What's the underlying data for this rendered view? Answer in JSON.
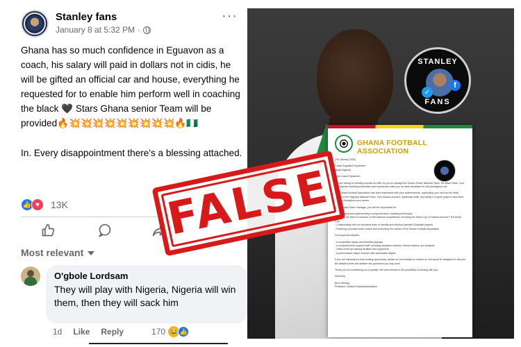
{
  "post": {
    "page_name": "Stanley fans",
    "date": "January 8 at 5:32 PM",
    "separator": "·",
    "paragraph1": "Ghana has so much confidence in Eguavon as a coach, his salary will paid in dollars not in cidis, he will be gifted an official car and house, everything he requested for to enable him perform well in coaching the black 🖤 Stars Ghana senior Team will be provided🔥💥💥💥💥💥💥💥💥💥🔥🇳🇬",
    "paragraph2": "In. Every disappointment there's a blessing attached.",
    "reaction_count": "13K",
    "share_count": "2",
    "reactions": [
      "like",
      "love"
    ]
  },
  "actions": {
    "like_icon": "thumbs-up-icon",
    "comment_icon": "speech-bubble-icon",
    "share_icon": "share-arrow-icon"
  },
  "filter": {
    "label": "Most relevant"
  },
  "comment": {
    "author": "O'gbole Lordsam",
    "text": "They will play with Nigeria, Nigeria will win them, then they will sack him",
    "age": "1d",
    "like_label": "Like",
    "reply_label": "Reply",
    "reaction_count": "170"
  },
  "image": {
    "badge_top": "STANLEY",
    "badge_bottom": "FANS",
    "letter_title": "GHANA FOOTBALL ASSOCIATION",
    "stamp_text": "FALSE",
    "stamp_color": "#d8191a",
    "letter": {
      "date": "[7th January 2025]",
      "recipient": "Coach Augustine Eguavoen",
      "location": "Abuja Nigeria]",
      "salutation": "Dear Coach Eguavoen,",
      "p1": "We are writing to formally propose an offer for you to manage the Ghana Senior National Team, the Black Stars. Your exceptional coaching credentials and experience make you an ideal candidate for this prestigious role.",
      "p2": "The Ghana Football Association has been impressed with your achievements, particularly your stint as the Head Coach of the Nigerian National Team. Your tactical acumen, leadership skills, and ability to inspire players have been evident throughout your career.",
      "p3": "As the Black Stars' manager, you will be responsible for:",
      "r1": "- Developing and implementing a comprehensive coaching philosophy",
      "r2": "- Leading the team to success in international competitions, including the Africa Cup of Nations and the FIFA World Cup",
      "r3": "- Collaborating with our technical team to identify and develop talented Ghanaian players",
      "r4": "- Fostering a positive team culture and promoting the values of the Ghana Football Association",
      "p4": "Our proposal includes:",
      "o1": "- A competitive salary and benefits package",
      "o2": "- A comprehensive support staff, including assistant coaches, fitness trainers, and analysts",
      "o3": "- State-of-the-art training facilities and equipment",
      "o4": "- A performance-based contract with achievable targets",
      "p5": "If you are interested in this exciting opportunity, please do not hesitate to contact us. We would be delighted to discuss the details further and answer any questions you may have.",
      "p6": "Thank you for considering our proposal. We look forward to the possibility of working with you.",
      "closing": "Sincerely,",
      "signer": "[Kurt Okraku]",
      "signer_title": "President, Ghana Football Association"
    }
  }
}
